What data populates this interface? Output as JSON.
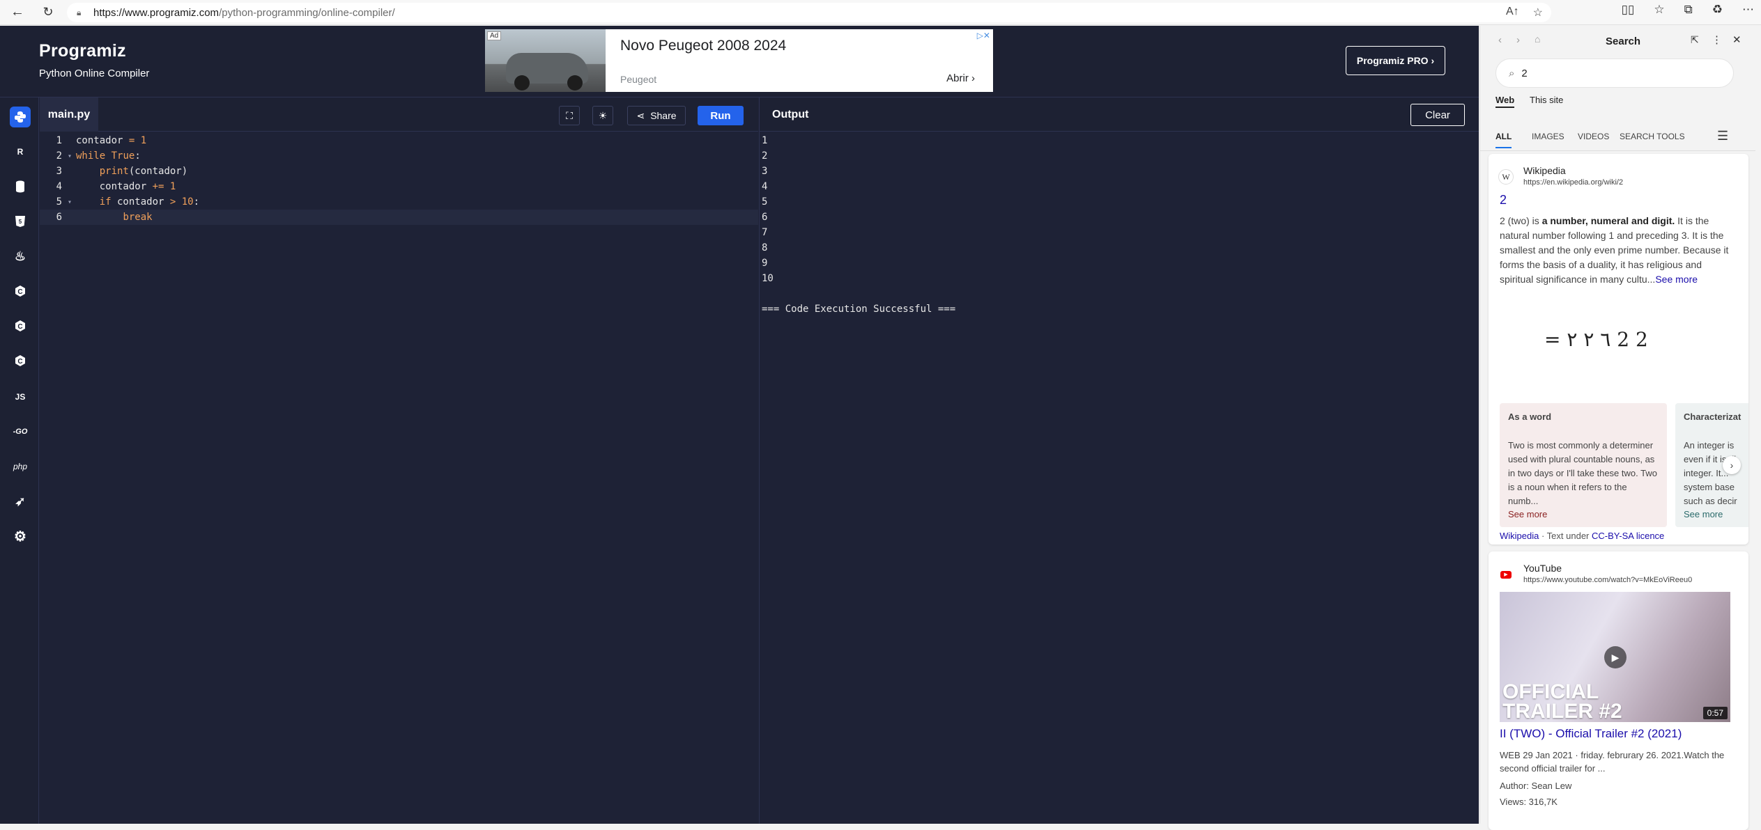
{
  "browser": {
    "url_host": "https://www.programiz.com",
    "url_path": "/python-programming/online-compiler/"
  },
  "header": {
    "logo": "Programiz",
    "subtitle": "Python Online Compiler",
    "pro_button": "Programiz PRO ›"
  },
  "ad": {
    "badge": "Ad",
    "title": "Novo Peugeot 2008 2024",
    "brand": "Peugeot",
    "cta": "Abrir ›",
    "close": "▷✕"
  },
  "languages": [
    "python",
    "r",
    "sql",
    "html",
    "java",
    "c",
    "cpp",
    "csharp",
    "js",
    "go",
    "php",
    "swift",
    "rust"
  ],
  "editor": {
    "filename": "main.py",
    "share": "Share",
    "run": "Run",
    "line_numbers": [
      "1",
      "2",
      "3",
      "4",
      "5",
      "6"
    ],
    "lines": [
      "contador = 1",
      "while True:",
      "    print(contador)",
      "    contador += 1",
      "    if contador > 10:",
      "        break"
    ]
  },
  "output": {
    "title": "Output",
    "clear": "Clear",
    "lines": [
      "1",
      "2",
      "3",
      "4",
      "5",
      "6",
      "7",
      "8",
      "9",
      "10",
      "",
      "=== Code Execution Successful ==="
    ]
  },
  "search": {
    "title": "Search",
    "query": "2",
    "scope_web": "Web",
    "scope_site": "This site",
    "tabs": [
      "ALL",
      "IMAGES",
      "VIDEOS",
      "SEARCH TOOLS"
    ],
    "wiki": {
      "source": "Wikipedia",
      "url": "https://en.wikipedia.org/wiki/2",
      "link": "2",
      "text_pre": "2 (two) is ",
      "text_bold": "a number, numeral and digit.",
      "text_post": " It is the natural number following 1 and preceding 3. It is the smallest and the only even prime number. Because it forms the basis of a duality, it has religious and spiritual significance in many cultu...",
      "see_more": "See more",
      "glyphs": "= ٦ ٢ ٢ 2 2",
      "card1_title": "As a word",
      "card1_text": "Two is most commonly a determiner used with plural countable nouns, as in two days or I'll take these two. Two is a noun when it refers to the numb...",
      "card1_more": "See more",
      "card2_title": "Characterizat",
      "card2_text": "An integer is even if it is di integer. It... system base such as decir",
      "card2_more": "See more",
      "license_src": "Wikipedia",
      "license_mid": " · Text under ",
      "license_link": "CC-BY-SA licence"
    },
    "youtube": {
      "source": "YouTube",
      "url": "https://www.youtube.com/watch?v=MkEoViReeu0",
      "overlay": "OFFICIAL TRAILER #2",
      "duration": "0:57",
      "title": "II (TWO) - Official Trailer #2 (2021)",
      "meta": "WEB 29 Jan 2021 · friday. februrary 26. 2021.Watch the second official trailer for ...",
      "author": "Author: Sean Lew",
      "views": "Views: 316,7K"
    }
  }
}
